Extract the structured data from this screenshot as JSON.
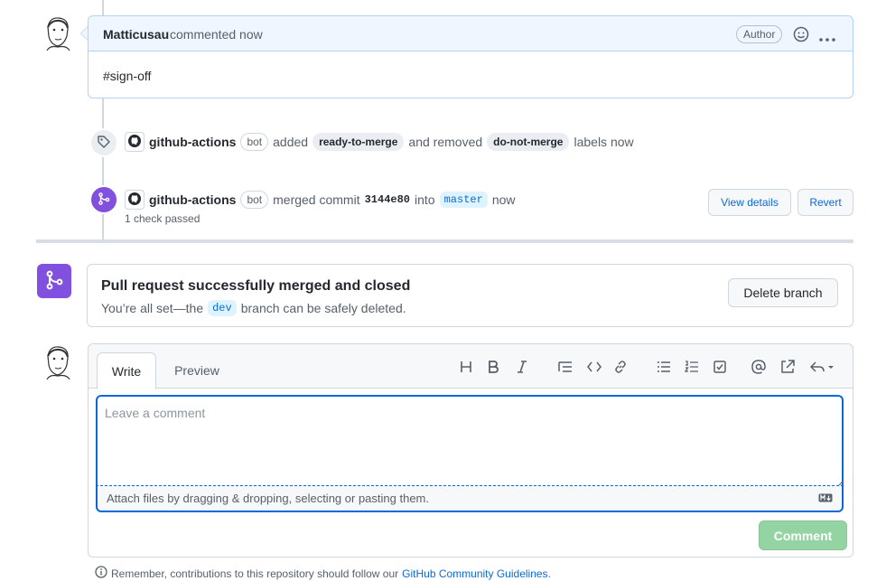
{
  "comment": {
    "author": "Matticusau",
    "meta": "commented now",
    "badge": "Author",
    "body": "#sign-off"
  },
  "label_event": {
    "actor": "github-actions",
    "bot_badge": "bot",
    "text_added": "added",
    "label_added": "ready-to-merge",
    "text_removed": "and removed",
    "label_removed": "do-not-merge",
    "text_tail": "labels now"
  },
  "merge_event": {
    "actor": "github-actions",
    "bot_badge": "bot",
    "text_merged": "merged commit",
    "commit": "3144e80",
    "text_into": "into",
    "branch": "master",
    "time": "now",
    "checks": "1 check passed",
    "view_details": "View details",
    "revert": "Revert"
  },
  "merged_box": {
    "title": "Pull request successfully merged and closed",
    "sub_pre": "You’re all set—the",
    "branch": "dev",
    "sub_post": "branch can be safely deleted.",
    "delete_button": "Delete branch"
  },
  "editor": {
    "tab_write": "Write",
    "tab_preview": "Preview",
    "placeholder": "Leave a comment",
    "attach_text": "Attach files by dragging & dropping, selecting or pasting them.",
    "comment_button": "Comment",
    "toolbar_icons": [
      "heading-icon",
      "bold-icon",
      "italic-icon",
      "quote-icon",
      "code-icon",
      "link-icon",
      "bullet-list-icon",
      "numbered-list-icon",
      "task-list-icon",
      "mention-icon",
      "reference-icon",
      "reply-icon"
    ]
  },
  "footer": {
    "text": "Remember, contributions to this repository should follow our",
    "link": "GitHub Community Guidelines",
    "period": "."
  },
  "colors": {
    "accent": "#0969da",
    "merged_purple": "#8250df",
    "comment_green_disabled": "#94d3a2"
  }
}
